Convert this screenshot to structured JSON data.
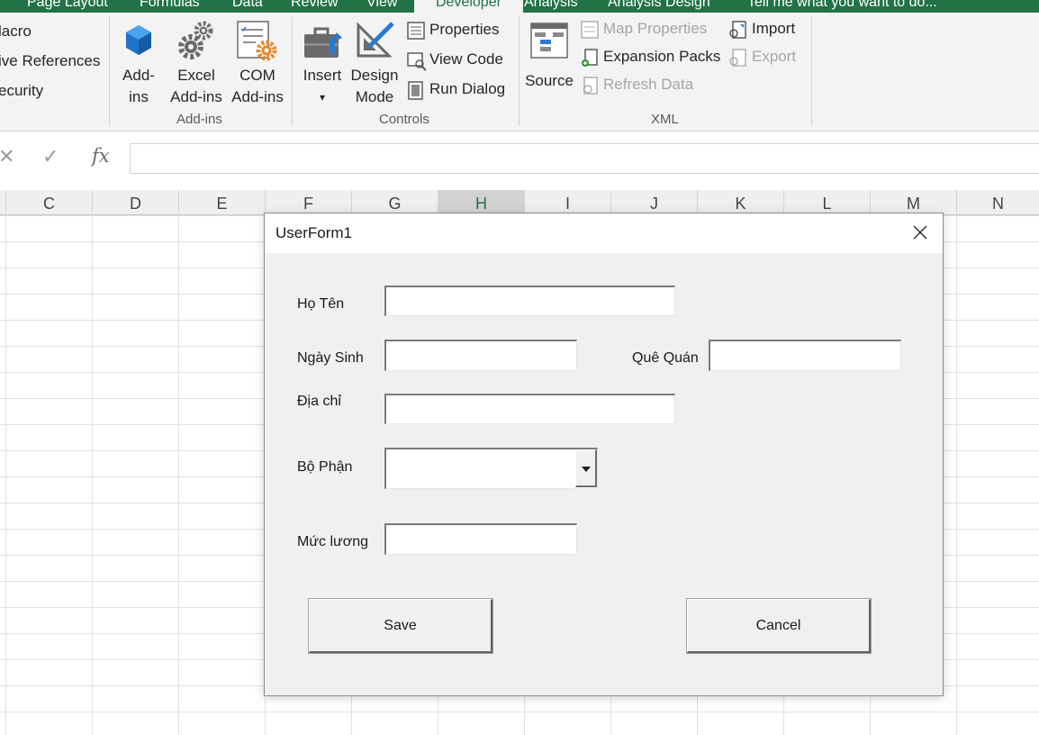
{
  "ribbon_tabs": [
    "Page Layout",
    "Formulas",
    "Data",
    "Review",
    "View",
    "Developer",
    "Analysis",
    "Analysis Design",
    "Tell me what you want to do..."
  ],
  "active_tab": "Developer",
  "code_group": {
    "items": [
      "lacro",
      "ive References",
      "ecurity"
    ]
  },
  "addins_group": {
    "label": "Add-ins",
    "buttons": [
      {
        "line1": "Add-",
        "line2": "ins",
        "icon": "addins-cube-icon"
      },
      {
        "line1": "Excel",
        "line2": "Add-ins",
        "icon": "excel-addins-gear-icon"
      },
      {
        "line1": "COM",
        "line2": "Add-ins",
        "icon": "com-addins-icon"
      }
    ]
  },
  "controls_group": {
    "label": "Controls",
    "insert": {
      "line1": "Insert",
      "line2": "▾"
    },
    "design": {
      "line1": "Design",
      "line2": "Mode"
    },
    "small": [
      "Properties",
      "View Code",
      "Run Dialog"
    ]
  },
  "xml_group": {
    "label": "XML",
    "source": "Source",
    "col1": [
      "Map Properties",
      "Expansion Packs",
      "Refresh Data"
    ],
    "col2": [
      "Import",
      "Export"
    ]
  },
  "formula_bar": {
    "cancel": "✕",
    "enter": "✓",
    "fx": "fx",
    "value": ""
  },
  "columns": [
    "C",
    "D",
    "E",
    "F",
    "G",
    "H",
    "I",
    "J",
    "K",
    "L",
    "M",
    "N"
  ],
  "selected_column": "H",
  "userform": {
    "title": "UserForm1",
    "labels": {
      "ho_ten": "Họ Tên",
      "ngay_sinh": "Ngày Sinh",
      "que_quan": "Quê Quán",
      "dia_chi": "Địa chỉ",
      "bo_phan": "Bộ Phận",
      "muc_luong": "Mức lương"
    },
    "values": {
      "ho_ten": "",
      "ngay_sinh": "",
      "que_quan": "",
      "dia_chi": "",
      "bo_phan": "",
      "muc_luong": ""
    },
    "save_label": "Save",
    "cancel_label": "Cancel"
  },
  "colors": {
    "excel_green": "#217346",
    "ribbon_bg": "#f3f3f3",
    "dialog_bg": "#f0f0f0"
  }
}
